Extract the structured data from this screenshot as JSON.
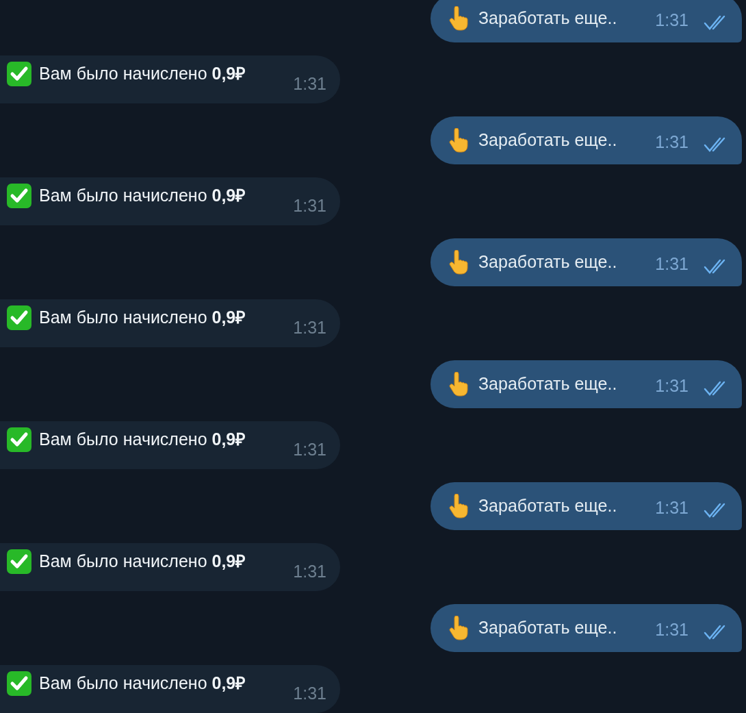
{
  "messages": [
    {
      "kind": "outgoing",
      "text": "Заработать еще..",
      "time": "1:31",
      "read": true
    },
    {
      "kind": "incoming",
      "text": "Вам было начислено **0,9₽**",
      "time": "1:31"
    },
    {
      "kind": "outgoing",
      "text": "Заработать еще..",
      "time": "1:31",
      "read": true
    },
    {
      "kind": "incoming",
      "text": "Вам было начислено **0,9₽**",
      "time": "1:31"
    },
    {
      "kind": "outgoing",
      "text": "Заработать еще..",
      "time": "1:31",
      "read": true
    },
    {
      "kind": "incoming",
      "text": "Вам было начислено **0,9₽**",
      "time": "1:31"
    },
    {
      "kind": "outgoing",
      "text": "Заработать еще..",
      "time": "1:31",
      "read": true
    },
    {
      "kind": "incoming",
      "text": "Вам было начислено **0,9₽**",
      "time": "1:31"
    },
    {
      "kind": "outgoing",
      "text": "Заработать еще..",
      "time": "1:31",
      "read": true
    },
    {
      "kind": "incoming",
      "text": "Вам было начислено **0,9₽**",
      "time": "1:31"
    },
    {
      "kind": "outgoing",
      "text": "Заработать еще..",
      "time": "1:31",
      "read": true
    },
    {
      "kind": "incoming",
      "text": "Вам было начислено **0,9₽**",
      "time": "1:31"
    }
  ]
}
